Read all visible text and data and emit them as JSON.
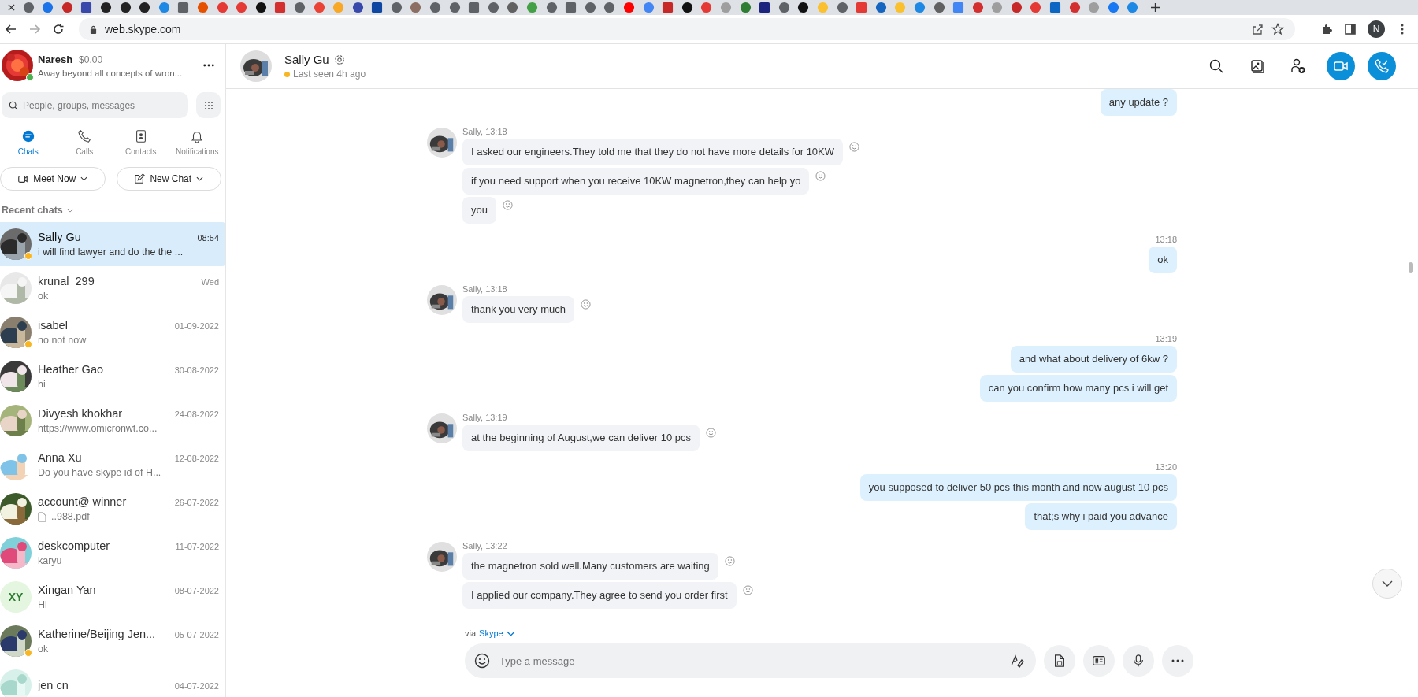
{
  "browser": {
    "url": "web.skype.com",
    "profile_initial": "N"
  },
  "profile": {
    "name": "Naresh",
    "credit": "$0.00",
    "mood": "Away beyond all concepts of wron...",
    "online": true
  },
  "search": {
    "placeholder": "People, groups, messages"
  },
  "nav": [
    {
      "label": "Chats",
      "kind": "chats",
      "selected": true
    },
    {
      "label": "Calls",
      "kind": "calls",
      "selected": false
    },
    {
      "label": "Contacts",
      "kind": "contacts",
      "selected": false
    },
    {
      "label": "Notifications",
      "kind": "notifications",
      "selected": false
    }
  ],
  "actions": [
    {
      "label": "Meet Now",
      "kind": "meet"
    },
    {
      "label": "New Chat",
      "kind": "new"
    }
  ],
  "recent_label": "Recent chats",
  "chats": [
    {
      "name": "Sally Gu",
      "time": "08:54",
      "preview": "i will find lawyer and do the the ...",
      "selected": true,
      "away": true,
      "file": false
    },
    {
      "name": "krunal_299",
      "time": "Wed",
      "preview": "ok",
      "selected": false,
      "away": false,
      "file": false
    },
    {
      "name": "isabel",
      "time": "01-09-2022",
      "preview": "no not now",
      "selected": false,
      "away": true,
      "file": false
    },
    {
      "name": "Heather Gao",
      "time": "30-08-2022",
      "preview": "hi",
      "selected": false,
      "away": false,
      "file": false
    },
    {
      "name": "Divyesh khokhar",
      "time": "24-08-2022",
      "preview": "https://www.omicronwt.co...",
      "selected": false,
      "away": false,
      "file": false
    },
    {
      "name": "Anna Xu",
      "time": "12-08-2022",
      "preview": "Do you have skype id of H...",
      "selected": false,
      "away": false,
      "file": false
    },
    {
      "name": "account@ winner",
      "time": "26-07-2022",
      "preview": "..988.pdf",
      "selected": false,
      "away": false,
      "file": true
    },
    {
      "name": "deskcomputer",
      "time": "11-07-2022",
      "preview": "karyu",
      "selected": false,
      "away": false,
      "file": false
    },
    {
      "name": "Xingan  Yan",
      "time": "08-07-2022",
      "preview": "Hi",
      "selected": false,
      "away": false,
      "file": false,
      "initials": "XY"
    },
    {
      "name": "Katherine/Beijing Jen...",
      "time": "05-07-2022",
      "preview": "ok",
      "selected": false,
      "away": true,
      "file": false
    },
    {
      "name": "jen cn",
      "time": "04-07-2022",
      "selected": false,
      "away": false,
      "file": false
    }
  ],
  "conversation": {
    "name": "Sally Gu",
    "status": "Last seen 4h ago",
    "away": true,
    "groups": [
      {
        "kind": "outgoing",
        "messages": [
          "any update ?"
        ]
      },
      {
        "kind": "incoming",
        "header": "Sally, 13:18",
        "messages": [
          "I asked our engineers.They told me that they do not have more details for 10KW",
          "if you need support when you receive 10KW magnetron,they can help yo",
          "you"
        ]
      },
      {
        "kind": "outgoing",
        "header": "13:18",
        "messages": [
          "ok"
        ]
      },
      {
        "kind": "incoming",
        "header": "Sally, 13:18",
        "messages": [
          "thank you very much"
        ]
      },
      {
        "kind": "outgoing",
        "header": "13:19",
        "messages": [
          "and what about delivery of 6kw ?",
          "can you confirm how many pcs i will get"
        ]
      },
      {
        "kind": "incoming",
        "header": "Sally, 13:19",
        "messages": [
          "at the beginning of August,we can deliver 10 pcs"
        ]
      },
      {
        "kind": "outgoing",
        "header": "13:20",
        "messages": [
          "you supposed to deliver 50 pcs this month and now august 10 pcs",
          "that;s why i paid you advance"
        ]
      },
      {
        "kind": "incoming",
        "header": "Sally, 13:22",
        "messages": [
          "the magnetron sold well.Many customers are waiting",
          "I applied our company.They agree to send you order first"
        ]
      }
    ],
    "via": "via",
    "via_link": "Skype",
    "composer": {
      "placeholder": "Type a message"
    }
  }
}
